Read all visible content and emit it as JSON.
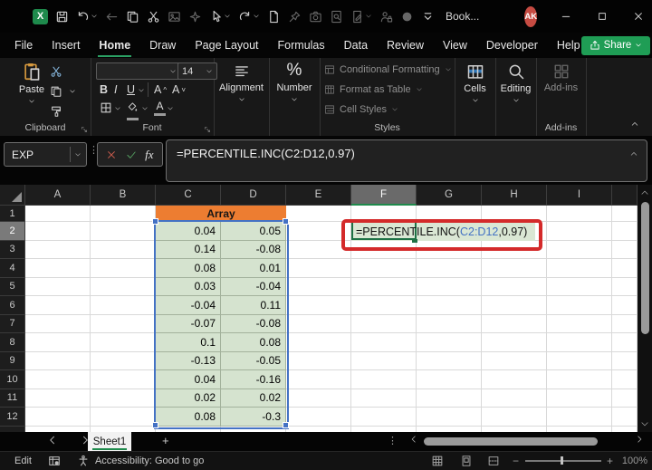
{
  "titlebar": {
    "workbook_name": "Book...",
    "avatar_initials": "AK",
    "icons": [
      {
        "name": "excel-logo"
      },
      {
        "name": "save-icon"
      },
      {
        "name": "undo-icon",
        "chevron": true
      },
      {
        "name": "back-arrow-icon",
        "disabled": true
      },
      {
        "name": "copy-icon"
      },
      {
        "name": "cut-icon"
      },
      {
        "name": "picture-icon",
        "disabled": true
      },
      {
        "name": "sensitivity-icon",
        "disabled": true
      },
      {
        "name": "touch-mode-icon",
        "chevron": true
      },
      {
        "name": "redo-icon",
        "chevron": true
      },
      {
        "name": "new-file-icon"
      },
      {
        "name": "pin-icon",
        "disabled": true
      },
      {
        "name": "camera-icon",
        "disabled": true
      },
      {
        "name": "lookup-icon",
        "disabled": true
      },
      {
        "name": "edit-document-icon",
        "chevron": true,
        "disabled": true
      },
      {
        "name": "privacy-icon",
        "disabled": true
      },
      {
        "name": "status-circle-icon",
        "disabled": true
      },
      {
        "name": "toolbar-overflow-icon"
      }
    ]
  },
  "menu": {
    "tabs": [
      "File",
      "Insert",
      "Home",
      "Draw",
      "Page Layout",
      "Formulas",
      "Data",
      "Review",
      "View",
      "Developer",
      "Help"
    ],
    "active_tab": "Home",
    "share_label": "Share"
  },
  "ribbon": {
    "clipboard": {
      "paste_label": "Paste",
      "group_label": "Clipboard"
    },
    "font": {
      "font_name": "",
      "font_size": "14",
      "bold": "B",
      "italic": "I",
      "underline": "U",
      "group_label": "Font"
    },
    "alignment": {
      "label": "Alignment"
    },
    "number": {
      "label": "Number",
      "percent_glyph": "%"
    },
    "styles": {
      "items": [
        "Conditional Formatting",
        "Format as Table",
        "Cell Styles"
      ],
      "group_label": "Styles"
    },
    "cells": {
      "label": "Cells"
    },
    "editing": {
      "label": "Editing"
    },
    "addins": {
      "button_label": "Add-ins",
      "group_label": "Add-ins"
    }
  },
  "formula_bar": {
    "name_box_value": "EXP",
    "fx_label": "fx",
    "formula": "=PERCENTILE.INC(C2:D12,0.97)"
  },
  "grid": {
    "column_headers": [
      "A",
      "B",
      "C",
      "D",
      "E",
      "F",
      "G",
      "H",
      "I"
    ],
    "active_column": "F",
    "row_headers": [
      "1",
      "2",
      "3",
      "4",
      "5",
      "6",
      "7",
      "8",
      "9",
      "10",
      "11",
      "12"
    ],
    "active_row": "2",
    "array_header": "Array",
    "values": [
      [
        "0.04",
        "0.05"
      ],
      [
        "0.14",
        "-0.08"
      ],
      [
        "0.08",
        "0.01"
      ],
      [
        "0.03",
        "-0.04"
      ],
      [
        "-0.04",
        "0.11"
      ],
      [
        "-0.07",
        "-0.08"
      ],
      [
        "0.1",
        "0.08"
      ],
      [
        "-0.13",
        "-0.05"
      ],
      [
        "0.04",
        "-0.16"
      ],
      [
        "0.02",
        "0.02"
      ],
      [
        "0.08",
        "-0.3"
      ]
    ],
    "formula_cell": {
      "prefix": "=PERCENTILE.INC(",
      "reference": "C2:D12",
      "suffix": ",0.97)"
    }
  },
  "sheet_bar": {
    "active_tab": "Sheet1"
  },
  "status_bar": {
    "mode": "Edit",
    "accessibility_text": "Accessibility: Good to go",
    "zoom_label": "100%"
  },
  "colors": {
    "accent_green": "#1E8A4C",
    "share_green": "#1F9D55",
    "header_orange": "#ED7D31",
    "cell_green": "#D5E3CF",
    "reference_blue": "#4472C4",
    "annotation_red": "#D42A2A",
    "avatar_red": "#C64B42"
  }
}
